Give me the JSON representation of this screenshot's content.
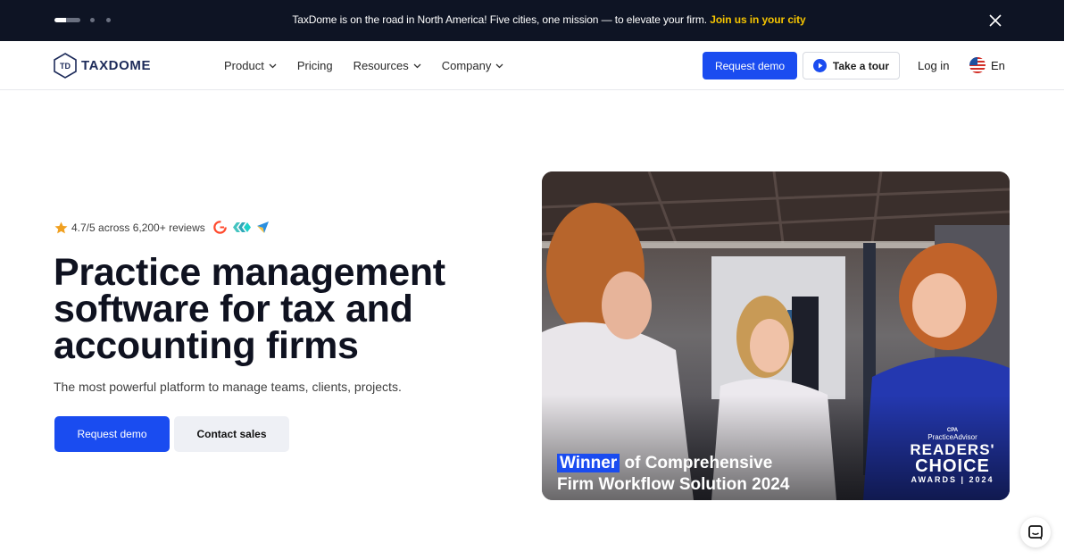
{
  "announcement": {
    "text": "TaxDome is on the road in North America! Five cities, one mission — to elevate your firm.",
    "link": "Join us in your city"
  },
  "header": {
    "logo_text": "TAXDOME",
    "nav": [
      {
        "label": "Product",
        "has_dropdown": true
      },
      {
        "label": "Pricing",
        "has_dropdown": false
      },
      {
        "label": "Resources",
        "has_dropdown": true
      },
      {
        "label": "Company",
        "has_dropdown": true
      }
    ],
    "request_demo": "Request demo",
    "take_tour": "Take a tour",
    "login": "Log in",
    "language": "En"
  },
  "hero": {
    "rating": "4.7/5 across 6,200+ reviews",
    "headline": "Practice management software for tax and accounting firms",
    "subline": "The most powerful platform to manage teams, clients, projects.",
    "primary_cta": "Request demo",
    "secondary_cta": "Contact sales"
  },
  "video": {
    "award_highlight": "Winner",
    "award_line1_rest": "of Comprehensive",
    "award_line2": "Firm Workflow Solution 2024",
    "badge": {
      "cpa": "CPA",
      "publication": "PracticeAdvisor",
      "readers": "READERS'",
      "choice": "CHOICE",
      "awards": "AWARDS | 2024"
    }
  },
  "colors": {
    "accent": "#1a4cf0",
    "announcement_bg": "#0e1424",
    "announcement_link": "#f5c400"
  }
}
